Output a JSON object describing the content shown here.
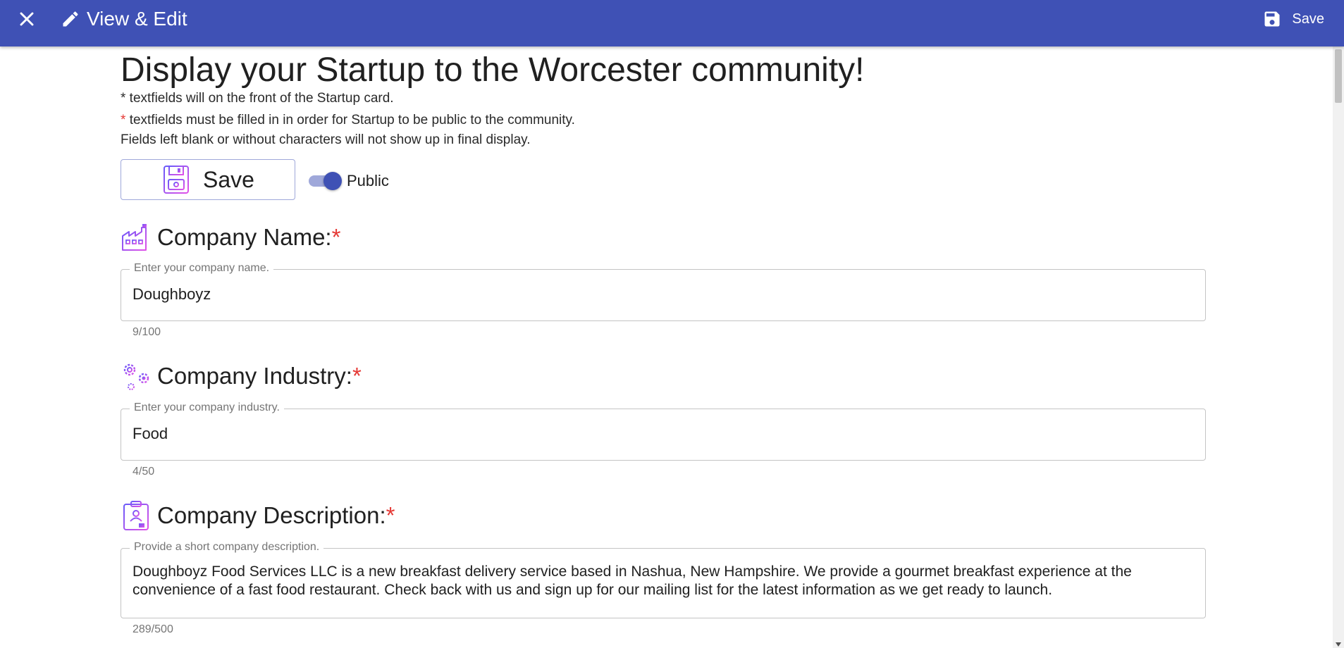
{
  "appbar": {
    "close_icon": "close-icon",
    "edit_icon": "pencil-icon",
    "title": "View & Edit",
    "save_icon": "floppy-disk-icon",
    "save_label": "Save",
    "bg_color": "#3f51b5"
  },
  "page": {
    "heading": "Display your Startup to the Worcester community!",
    "notes": [
      "* textfields will on the front of the Startup card.",
      "textfields must be filled in in order for Startup to be public to the community.",
      "Fields left blank or without characters will not show up in final display."
    ],
    "required_marker": "*",
    "required_color": "#e53935"
  },
  "actions": {
    "save_label": "Save",
    "save_icon": "floppy-disk-icon",
    "public_toggle": {
      "label": "Public",
      "on": true
    }
  },
  "fields": [
    {
      "title": "Company Name:",
      "icon": "factory-icon",
      "required": "*",
      "legend": "Enter your company name.",
      "value": "Doughboyz",
      "counter": "9/100"
    },
    {
      "title": "Company Industry:",
      "icon": "gears-icon",
      "required": "*",
      "legend": "Enter your company industry.",
      "value": "Food",
      "counter": "4/50"
    },
    {
      "title": "Company Description:",
      "icon": "id-card-icon",
      "required": "*",
      "legend": "Provide a short company description.",
      "value": "Doughboyz Food Services LLC is a new breakfast delivery service based in Nashua, New Hampshire. We provide a gourmet breakfast experience at the convenience of a fast food restaurant. Check back with us and sign up for our mailing list for the latest information as we get ready to launch.",
      "counter": "289/500"
    }
  ]
}
